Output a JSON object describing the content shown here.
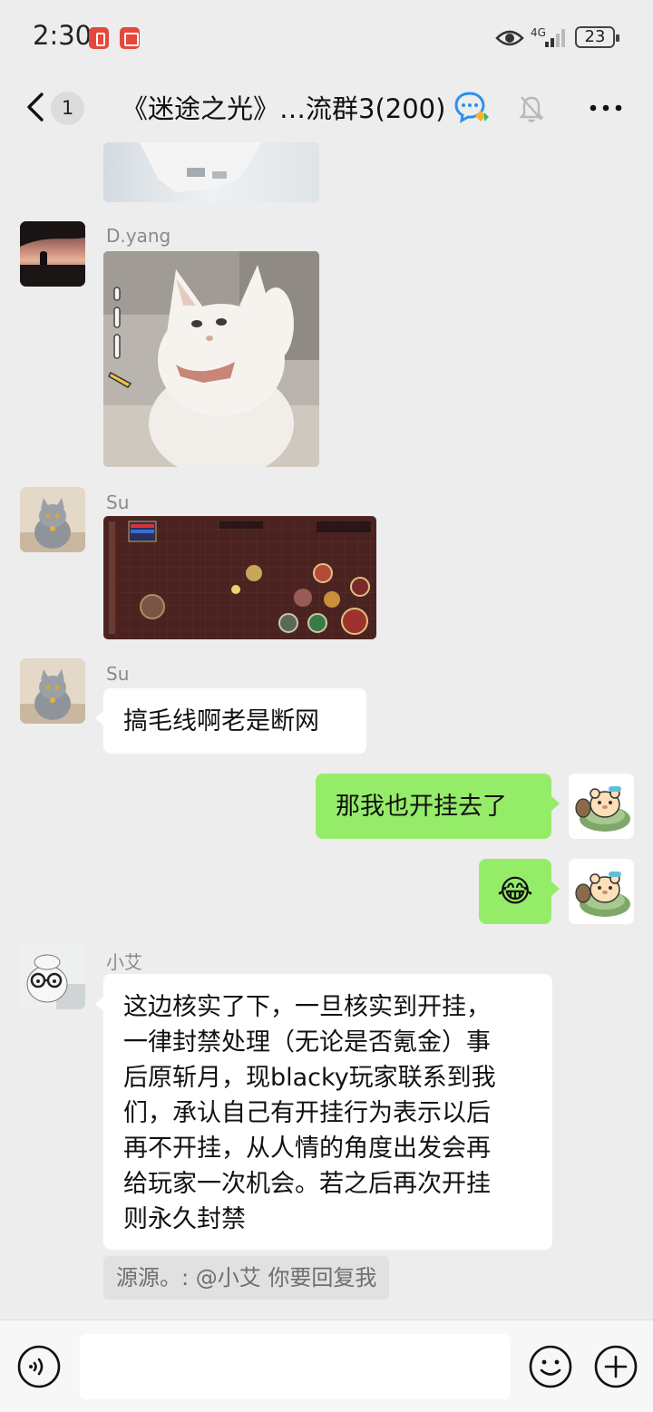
{
  "status_bar": {
    "time": "2:30",
    "network": "4G",
    "battery": "23"
  },
  "nav": {
    "back_count": "1",
    "title": "《迷途之光》…流群3(200)"
  },
  "messages": [
    {
      "sender": "D.yang",
      "type": "image",
      "image_description": "white-cat-sticker"
    },
    {
      "sender": "Su",
      "type": "image",
      "image_description": "game-screenshot"
    },
    {
      "sender": "Su",
      "type": "text",
      "text": "搞毛线啊老是断网"
    },
    {
      "sender": "me",
      "type": "text",
      "text": "那我也开挂去了"
    },
    {
      "sender": "me",
      "type": "emoji",
      "text": "😂"
    },
    {
      "sender": "小艾",
      "type": "text",
      "text": "这边核实了下，一旦核实到开挂，一律封禁处理（无论是否氪金）事后原斩月，现blacky玩家联系到我们，承认自己有开挂行为表示以后再不开挂，从人情的角度出发会再给玩家一次机会。若之后再次开挂则永久封禁"
    }
  ],
  "message_lines": [
    "这边核实了下，一旦核实到开挂，",
    "一律封禁处理（无论是否氪金）事",
    "后原斩月，现blacky玩家联系到我",
    "们，承认自己有开挂行为表示以后",
    "再不开挂，从人情的角度出发会再",
    "给玩家一次机会。若之后再次开挂",
    "则永久封禁"
  ],
  "quote": "源源。: @小艾 你要回复我",
  "colors": {
    "background": "#ededed",
    "out_bubble": "#95ec69",
    "in_bubble": "#ffffff",
    "status_badge": "#e5473c"
  }
}
